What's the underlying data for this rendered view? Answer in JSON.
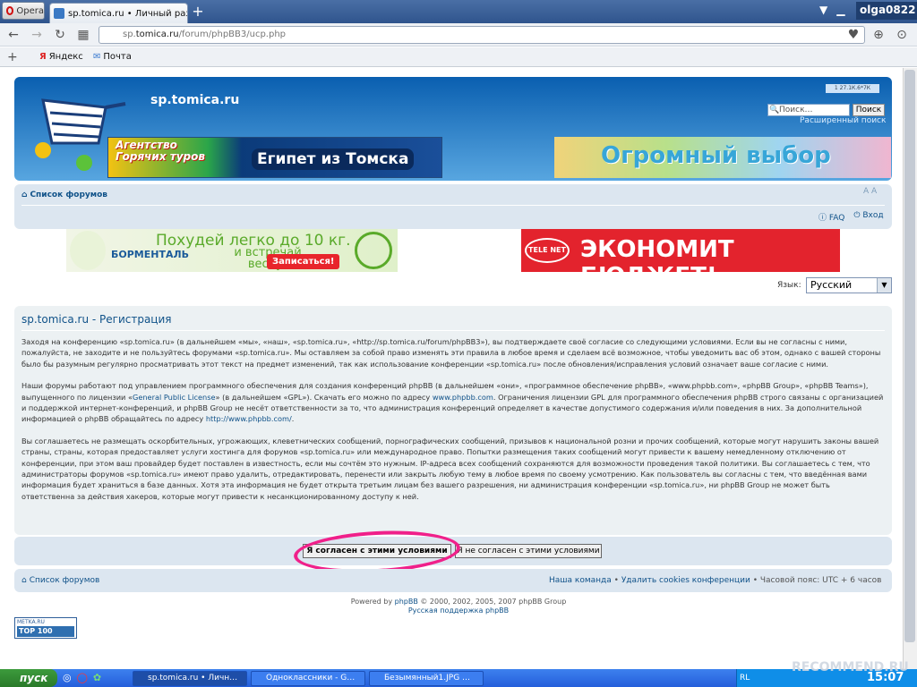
{
  "browser": {
    "menu_label": "Opera",
    "tab_title": "sp.tomica.ru • Личный разд",
    "user": "olga0822",
    "url_prefix": "sp.",
    "url_domain": "tomica.ru",
    "url_path": "/forum/phpBB3/ucp.php",
    "bookmarks": [
      "Яндекс",
      "Почта"
    ]
  },
  "site": {
    "title": "sp.tomica.ru",
    "search_placeholder": "Поиск…",
    "search_button": "Поиск",
    "advanced_search": "Расширенный поиск",
    "badge": "1 27.1К.6*7К"
  },
  "banners": {
    "tours_left": "Агентство Горячих туров",
    "tours_right": "Египет из Томска",
    "choice": "Огромный выбор",
    "diet_title": "Похудей легко до 10 кг.",
    "diet_sub": "и встречай весну!",
    "diet_brand": "БОРМЕНТАЛЬ",
    "diet_button": "Записаться!",
    "telenet_logo": "TELE NET",
    "telenet_text": "ЭКОНОМИТ БЮДЖЕТ!"
  },
  "nav": {
    "forum_list": "Список форумов",
    "faq": "FAQ",
    "login": "Вход",
    "collapse": "A A"
  },
  "lang": {
    "label": "Язык:",
    "selected": "Русский"
  },
  "registration": {
    "title": "sp.tomica.ru - Регистрация",
    "p1": "Заходя на конференцию «sp.tomica.ru» (в дальнейшем «мы», «наш», «sp.tomica.ru», «http://sp.tomica.ru/forum/phpBB3»), вы подтверждаете своё согласие со следующими условиями. Если вы не согласны с ними, пожалуйста, не заходите и не пользуйтесь форумами «sp.tomica.ru». Мы оставляем за собой право изменять эти правила в любое время и сделаем всё возможное, чтобы уведомить вас об этом, однако с вашей стороны было бы разумным регулярно просматривать этот текст на предмет изменений, так как использование конференции «sp.tomica.ru» после обновления/исправления условий означает ваше согласие с ними.",
    "p2a": "Наши форумы работают под управлением программного обеспечения для создания конференций phpBB (в дальнейшем «они», «программное обеспечение phpBB», «www.phpbb.com», «phpBB Group», «phpBB Teams»), выпущенного по лицензии «",
    "p2_link1": "General Public License",
    "p2b": "» (в дальнейшем «GPL»). Скачать его можно по адресу ",
    "p2_link2": "www.phpbb.com",
    "p2c": ". Ограничения лицензии GPL для программного обеспечения phpBB строго связаны с организацией и поддержкой интернет-конференций, и phpBB Group не несёт ответственности за то, что администрация конференций определяет в качестве допустимого содержания и/или поведения в них. За дополнительной информацией о phpBB обращайтесь по адресу ",
    "p2_link3": "http://www.phpbb.com/",
    "p2d": ".",
    "p3": "Вы соглашаетесь не размещать оскорбительных, угрожающих, клеветнических сообщений, порнографических сообщений, призывов к национальной розни и прочих сообщений, которые могут нарушить законы вашей страны, страны, которая предоставляет услуги хостинга для форумов «sp.tomica.ru» или международное право. Попытки размещения таких сообщений могут привести к вашему немедленному отключению от конференции, при этом ваш провайдер будет поставлен в известность, если мы сочтём это нужным. IP-адреса всех сообщений сохраняются для возможности проведения такой политики. Вы соглашаетесь с тем, что администраторы форумов «sp.tomica.ru» имеют право удалить, отредактировать, перенести или закрыть любую тему в любое время по своему усмотрению. Как пользователь вы согласны с тем, что введённая вами информация будет храниться в базе данных. Хотя эта информация не будет открыта третьим лицам без вашего разрешения, ни администрация конференции «sp.tomica.ru», ни phpBB Group не может быть ответственна за действия хакеров, которые могут привести к несанкционированному доступу к ней.",
    "agree_button": "Я согласен с этими условиями",
    "disagree_button": "Я не согласен с этими условиями"
  },
  "footer": {
    "forum_list": "Список форумов",
    "team": "Наша команда",
    "delete_cookies": "Удалить cookies конференции",
    "timezone": "Часовой пояс: UTC + 6 часов",
    "powered_prefix": "Powered by ",
    "powered_link": "phpBB",
    "powered_suffix": " © 2000, 2002, 2005, 2007 phpBB Group",
    "support": "Русская поддержка phpBB",
    "top100_small": "METKA.RU",
    "top100": "TOP 100"
  },
  "taskbar": {
    "start": "пуск",
    "buttons": [
      "sp.tomica.ru • Личн…",
      "Одноклассники - G…",
      "Безымянный1.JPG …"
    ],
    "lang": "RL",
    "clock": "15:07",
    "watermark": "RECOMMEND.RU"
  },
  "colors": {
    "link": "#105289",
    "header": "#0a5fb0",
    "circle": "#f0208a"
  }
}
